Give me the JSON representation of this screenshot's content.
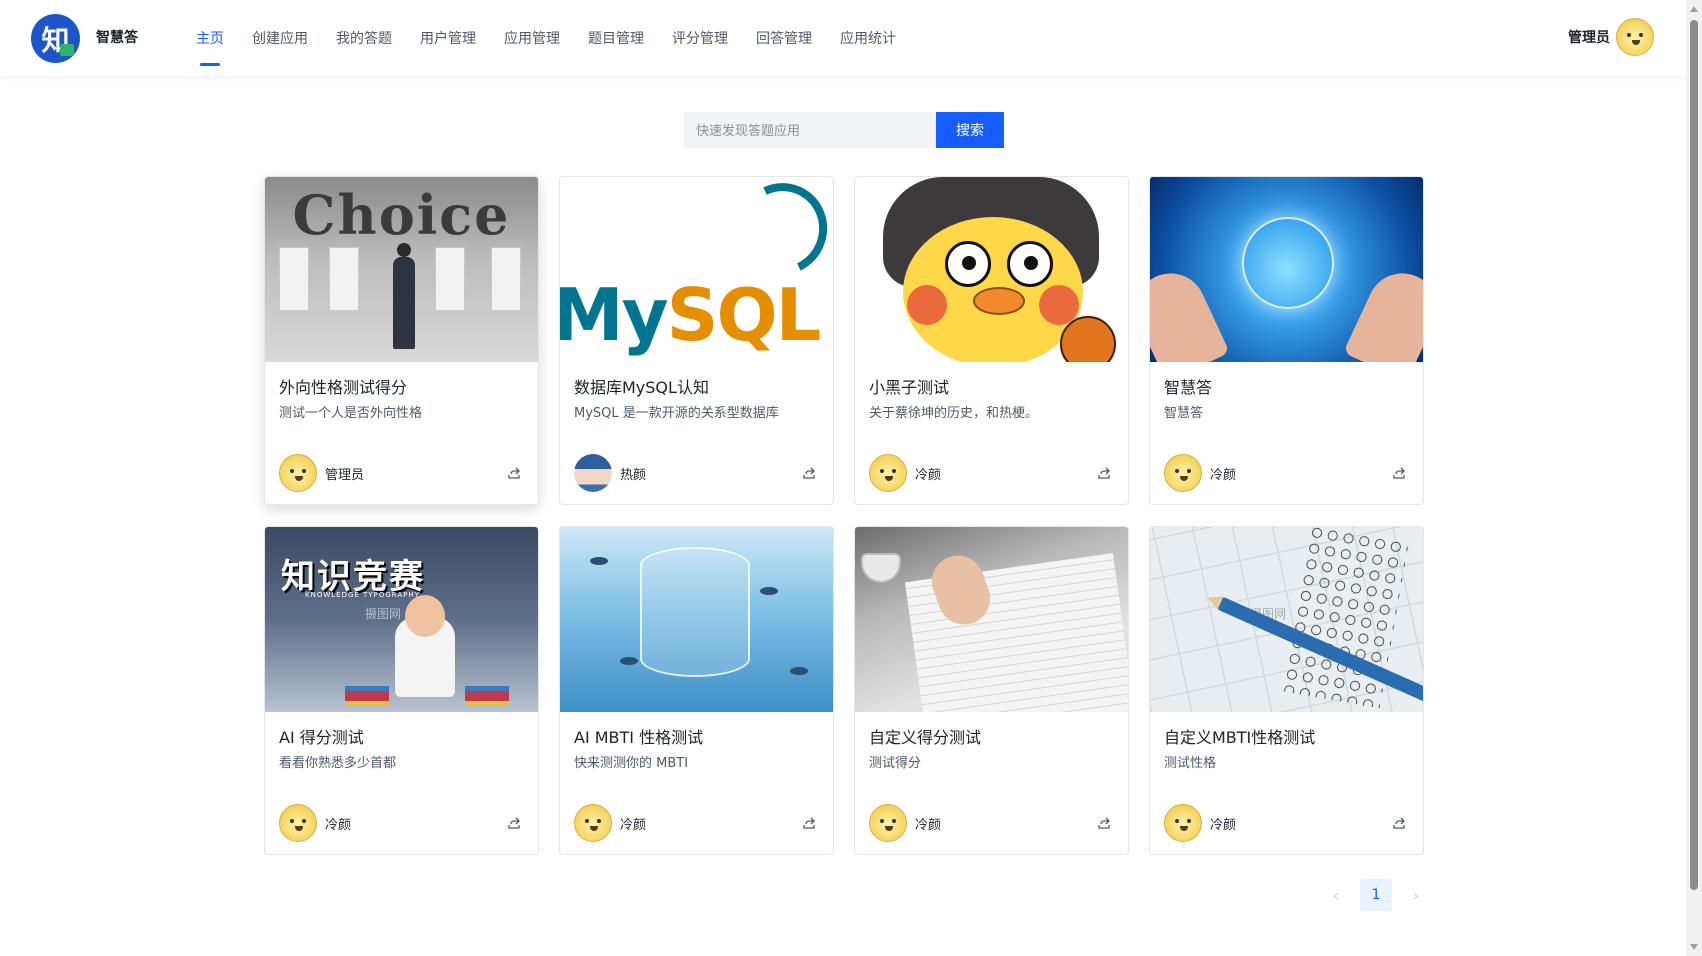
{
  "header": {
    "logo_char": "知",
    "app_name": "智慧答",
    "nav": [
      {
        "label": "主页",
        "active": true
      },
      {
        "label": "创建应用"
      },
      {
        "label": "我的答题"
      },
      {
        "label": "用户管理"
      },
      {
        "label": "应用管理"
      },
      {
        "label": "题目管理"
      },
      {
        "label": "评分管理"
      },
      {
        "label": "回答管理"
      },
      {
        "label": "应用统计"
      }
    ],
    "user_name": "管理员"
  },
  "search": {
    "placeholder": "快速发现答题应用",
    "button_label": "搜索"
  },
  "apps": [
    {
      "title": "外向性格测试得分",
      "desc": "测试一个人是否外向性格",
      "author": "管理员",
      "cover": "choice",
      "cover_text": "Choice"
    },
    {
      "title": "数据库MySQL认知",
      "desc": "MySQL 是一款开源的关系型数据库",
      "author": "热颜",
      "cover": "mysql",
      "cover_text_a": "My",
      "cover_text_b": "SQL"
    },
    {
      "title": "小黑子测试",
      "desc": "关于蔡徐坤的历史，和热梗。",
      "author": "冷颜",
      "cover": "duck"
    },
    {
      "title": "智慧答",
      "desc": "智慧答",
      "author": "冷颜",
      "cover": "tech"
    },
    {
      "title": "AI 得分测试",
      "desc": "看看你熟悉多少首都",
      "author": "冷颜",
      "cover": "kid",
      "cover_text": "知识竞赛",
      "cover_subtext": "KNOWLEDGE TYPOGRAPHY",
      "watermark": "摄图网"
    },
    {
      "title": "AI MBTI 性格测试",
      "desc": "快来测测你的 MBTI",
      "author": "冷颜",
      "cover": "ocean"
    },
    {
      "title": "自定义得分测试",
      "desc": "测试得分",
      "author": "冷颜",
      "cover": "paper"
    },
    {
      "title": "自定义MBTI性格测试",
      "desc": "测试性格",
      "author": "冷颜",
      "cover": "sheet",
      "watermark": "摄图网"
    }
  ],
  "pagination": {
    "current_page": "1",
    "prev_icon": "chevron-left-icon",
    "next_icon": "chevron-right-icon"
  },
  "colors": {
    "primary": "#165dff",
    "logo_bg": "#1e56c9",
    "text": "#1d2129",
    "muted": "#4e5969"
  }
}
